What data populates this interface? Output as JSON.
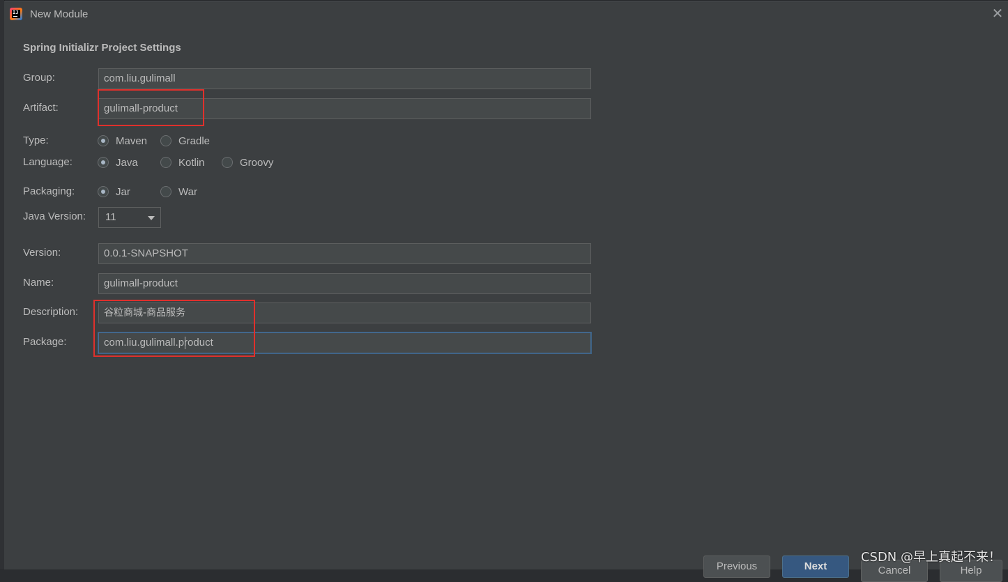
{
  "window": {
    "title": "New Module",
    "close_glyph": "✕"
  },
  "section_title": "Spring Initializr Project Settings",
  "form": {
    "group": {
      "label": "Group:",
      "value": "com.liu.gulimall"
    },
    "artifact": {
      "label": "Artifact:",
      "value": "gulimall-product"
    },
    "type": {
      "label": "Type:",
      "options": [
        "Maven",
        "Gradle"
      ],
      "selected": "Maven"
    },
    "language": {
      "label": "Language:",
      "options": [
        "Java",
        "Kotlin",
        "Groovy"
      ],
      "selected": "Java"
    },
    "packaging": {
      "label": "Packaging:",
      "options": [
        "Jar",
        "War"
      ],
      "selected": "Jar"
    },
    "java_version": {
      "label": "Java Version:",
      "value": "11"
    },
    "version": {
      "label": "Version:",
      "value": "0.0.1-SNAPSHOT"
    },
    "name": {
      "label": "Name:",
      "value": "gulimall-product"
    },
    "description": {
      "label": "Description:",
      "value": "谷粒商城-商品服务"
    },
    "package": {
      "label": "Package:",
      "value": "com.liu.gulimall.product"
    }
  },
  "buttons": {
    "previous": "Previous",
    "next": "Next",
    "cancel": "Cancel",
    "help": "Help"
  },
  "watermark": "CSDN @早上真起不来！",
  "colors": {
    "dialog_bg": "#3c3f41",
    "field_bg": "#45494a",
    "text": "#bbbbbb",
    "highlight": "#e0302c",
    "primary_button": "#365880",
    "focus_border": "#466d94"
  }
}
